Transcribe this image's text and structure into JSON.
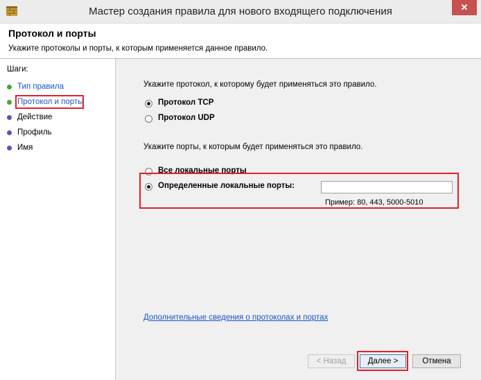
{
  "window": {
    "title": "Мастер создания правила для нового входящего подключения",
    "close_symbol": "✕"
  },
  "header": {
    "title": "Протокол и порты",
    "description": "Укажите протоколы и порты, к которым применяется данное правило."
  },
  "sidebar": {
    "label": "Шаги:",
    "items": [
      {
        "label": "Тип правила",
        "state": "done"
      },
      {
        "label": "Протокол и порты",
        "state": "current"
      },
      {
        "label": "Действие",
        "state": "pending"
      },
      {
        "label": "Профиль",
        "state": "pending"
      },
      {
        "label": "Имя",
        "state": "pending"
      }
    ]
  },
  "main": {
    "protocol_prompt": "Укажите протокол, к которому будет применяться это правило.",
    "protocol_tcp": "Протокол TCP",
    "protocol_udp": "Протокол UDP",
    "ports_prompt": "Укажите порты, к которым будет применяться это правило.",
    "all_ports": "Все локальные порты",
    "specific_ports": "Определенные локальные порты:",
    "ports_value": "",
    "example": "Пример: 80, 443, 5000-5010",
    "more_info_link": "Дополнительные сведения о протоколах и портах"
  },
  "buttons": {
    "back": "< Назад",
    "next": "Далее >",
    "cancel": "Отмена"
  },
  "colors": {
    "highlight": "#e0202a",
    "link": "#1a55c8",
    "step_done": "#4aa43b",
    "step_pending": "#6a4fb3"
  }
}
